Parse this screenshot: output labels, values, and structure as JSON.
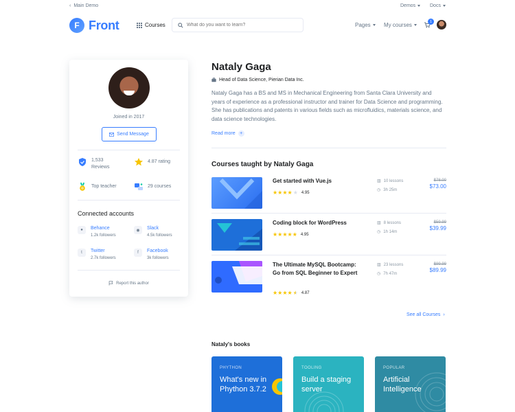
{
  "topbar": {
    "back_label": "Main Demo",
    "demos_label": "Demos",
    "docs_label": "Docs"
  },
  "header": {
    "logo_letter": "F",
    "logo_text": "Front",
    "courses_label": "Courses",
    "search_placeholder": "What do you want to learn?",
    "pages_label": "Pages",
    "my_courses_label": "My courses",
    "cart_count": "1"
  },
  "profile": {
    "joined": "Joined in 2017",
    "send_message": "Send Message",
    "stats": [
      {
        "icon": "shield-icon",
        "value": "1,533",
        "label": "Reviews"
      },
      {
        "icon": "star-icon",
        "value": "4.87 rating",
        "label": ""
      },
      {
        "icon": "medal-icon",
        "value": "Top teacher",
        "label": ""
      },
      {
        "icon": "book-icon",
        "value": "29 courses",
        "label": ""
      }
    ],
    "connected_title": "Connected accounts",
    "accounts": [
      {
        "name": "Behance",
        "followers": "1.2k followers",
        "icon": "github-icon"
      },
      {
        "name": "Slack",
        "followers": "4.5k followers",
        "icon": "dribbble-icon"
      },
      {
        "name": "Twitter",
        "followers": "2.7k followers",
        "icon": "twitter-icon"
      },
      {
        "name": "Facebook",
        "followers": "3k followers",
        "icon": "facebook-icon"
      }
    ],
    "report": "Report this author"
  },
  "main": {
    "name": "Nataly Gaga",
    "role": "Head of Data Science, Pierian Data Inc.",
    "bio": "Nataly Gaga has a BS and MS in Mechanical Engineering from Santa Clara University and years of experience as a professional instructor and trainer for Data Science and programming. She has publications and patents in various fields such as microfluidics, materials science, and data science technologies.",
    "read_more": "Read more",
    "courses_title": "Courses taught by Nataly Gaga",
    "courses": [
      {
        "title": "Get started with Vue.js",
        "rating": "4.95",
        "stars": 4,
        "lessons": "10 lessons",
        "duration": "3h 25m",
        "old_price": "$78.00",
        "price": "$73.00",
        "color": "#377dff"
      },
      {
        "title": "Coding block for WordPress",
        "rating": "4.95",
        "stars": 5,
        "lessons": "8 lessons",
        "duration": "1h 14m",
        "old_price": "$59.99",
        "price": "$39.99",
        "color": "#1e6fd9"
      },
      {
        "title": "The Ultimate MySQL Bootcamp: Go from SQL Beginner to Expert",
        "rating": "4.87",
        "stars": 4.5,
        "lessons": "23 lessons",
        "duration": "7h 47m",
        "old_price": "$99.99",
        "price": "$89.99",
        "color": "#2f6bff"
      }
    ],
    "see_all": "See all Courses",
    "books_title": "Nataly's books",
    "books": [
      {
        "category": "PHYTHON",
        "title": "What's new in Phython 3.7.2",
        "color": "#1e6fd9"
      },
      {
        "category": "TOOLING",
        "title": "Build a staging server",
        "color": "#2bb3c0"
      },
      {
        "category": "POPULAR",
        "title": "Artificial Intelligence",
        "color": "#2f8ba3"
      }
    ]
  }
}
